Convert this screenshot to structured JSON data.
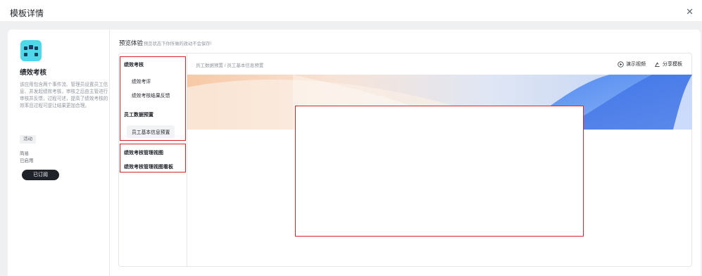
{
  "dialog": {
    "title": "模板详情",
    "close_icon": "close-icon"
  },
  "template": {
    "name": "绩效考核",
    "description": "该应用包含两个事件流、管理员设置员工信息、并发起绩效考核，审核之后由主管进行审核并反馈，过程可述，提高了绩效考核的效率且过程可逆让结果更加合理。",
    "tag": "活动",
    "meta": [
      "简易",
      "已启用"
    ],
    "subscribe_label": "已订阅",
    "icon_colors": {
      "bg": "#4ed8ea",
      "fg": "#1b3a5c"
    }
  },
  "preview": {
    "title": "预览体验",
    "note": "预览状态下你所做的改动不会保存!",
    "nav": {
      "group1": {
        "title": "绩效考核",
        "items": [
          "绩效考评",
          "绩效考核结果反馈"
        ]
      },
      "group2": {
        "title": "员工数据预置",
        "items": [
          "员工基本信息预置"
        ]
      },
      "group3": {
        "items": [
          "绩效考核管理视图",
          "绩效考核管理视图看板"
        ]
      }
    },
    "breadcrumb": "员工数据预置 / 员工基本信息预置",
    "actions": {
      "demo_video": "演示视频",
      "share_template": "分享模板"
    },
    "highlight_color": "#d7252c"
  }
}
